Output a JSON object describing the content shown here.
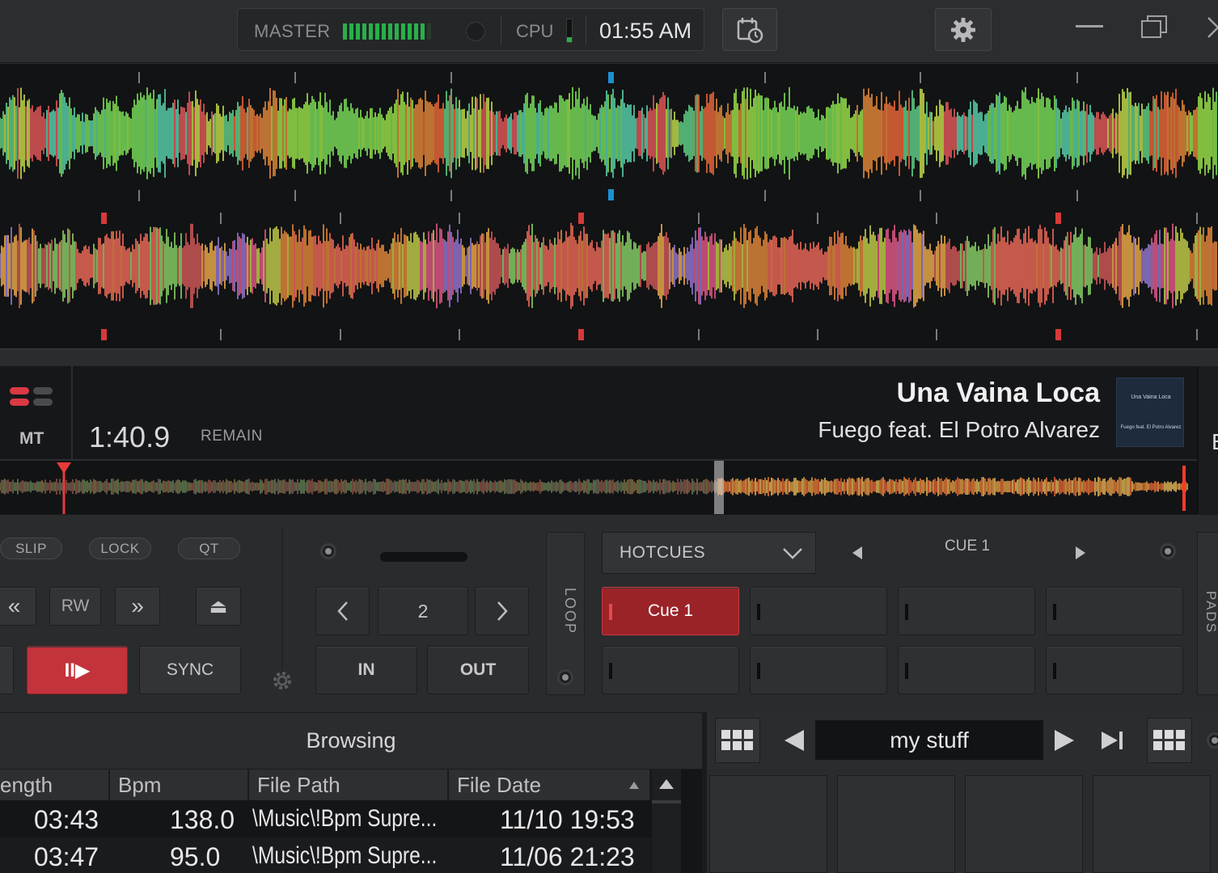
{
  "topbar": {
    "master_label": "MASTER",
    "cpu_label": "CPU",
    "clock": "01:55 AM",
    "icons": [
      "calendar-clock-icon",
      "gear-icon",
      "minimize-icon",
      "restore-icon",
      "close-icon"
    ],
    "cpu_load_fraction": 0.2,
    "master_level_segments_on": 13,
    "master_level_segments_total": 14
  },
  "deck": {
    "mode_label": "MT",
    "elapsed": "1:40.9",
    "remain_label": "REMAIN",
    "title": "Una Vaina Loca",
    "artist": "Fuego feat. El Potro Alvarez",
    "cover_title": "Una Vaina Loca",
    "cover_artist": "Fuego feat. El Potro Alvarez",
    "next_deck_label": "B",
    "play_progress_fraction": 0.6
  },
  "controls": {
    "slip": "SLIP",
    "lock": "LOCK",
    "qt": "QT",
    "rewind_fast": "«",
    "rw": "RW",
    "forward_fast": "»",
    "eject": "⏏",
    "play_pause": "II▶",
    "sync": "SYNC",
    "loop_size": "2",
    "loop_in": "IN",
    "loop_out": "OUT",
    "loop_label": "LOOP",
    "hotcues_dropdown": "HOTCUES",
    "cue_nav_label": "CUE 1",
    "cue_pads": [
      "Cue 1",
      "",
      "",
      "",
      "",
      "",
      "",
      ""
    ],
    "pads_label": "PADS"
  },
  "browser": {
    "title": "Browsing",
    "columns": [
      "ength",
      "Bpm",
      "File Path",
      "File Date"
    ],
    "rows": [
      {
        "length": "03:43",
        "bpm": "138.0",
        "path": "\\Music\\!Bpm Supre...",
        "date": "11/10 19:53"
      },
      {
        "length": "03:47",
        "bpm": "95.0",
        "path": "\\Music\\!Bpm Supre...",
        "date": "11/06 21:23"
      }
    ]
  },
  "sidepanel": {
    "playlist_name": "my stuff"
  },
  "colors": {
    "accent_red": "#c3333b",
    "meter_green": "#28b04b",
    "beat_marker_blue": "#1c8fd0",
    "cue_marker_red": "#d63a3a"
  }
}
